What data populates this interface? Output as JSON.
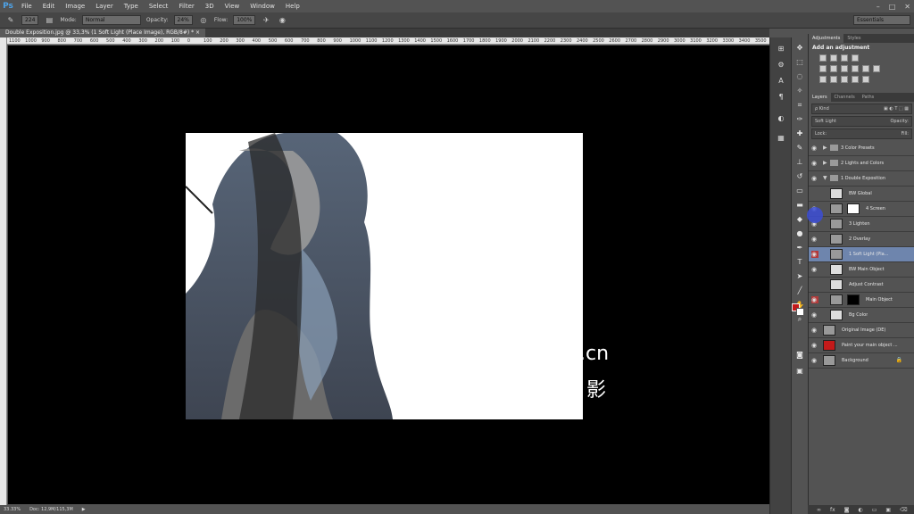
{
  "app": {
    "logo": "Ps"
  },
  "menu": [
    "File",
    "Edit",
    "Image",
    "Layer",
    "Type",
    "Select",
    "Filter",
    "3D",
    "View",
    "Window",
    "Help"
  ],
  "window_controls": [
    "–",
    "□",
    "✕"
  ],
  "options": {
    "brush_size": "224",
    "mode_label": "Mode:",
    "mode_value": "Normal",
    "opacity_label": "Opacity:",
    "opacity_value": "24%",
    "flow_label": "Flow:",
    "flow_value": "100%",
    "workspace": "Essentials"
  },
  "document": {
    "tab": "Double Exposition.jpg @ 33,3% (1 Soft Light (Place Image), RGB/8#) *  ×",
    "ruler_ticks": [
      "1100",
      "1000",
      "900",
      "800",
      "700",
      "600",
      "500",
      "400",
      "300",
      "200",
      "100",
      "0",
      "100",
      "200",
      "300",
      "400",
      "500",
      "600",
      "700",
      "800",
      "900",
      "1000",
      "1100",
      "1200",
      "1300",
      "1400",
      "1500",
      "1600",
      "1700",
      "1800",
      "1900",
      "2000",
      "2100",
      "2200",
      "2300",
      "2400",
      "2500",
      "2600",
      "2700",
      "2800",
      "2900",
      "3000",
      "3100",
      "3200",
      "3300",
      "3400",
      "3500"
    ],
    "watermark": "5.cn",
    "watermark_glyph": "影"
  },
  "status": {
    "zoom": "33.33%",
    "doc": "Doc: 12,9M/115,3M"
  },
  "panels": {
    "adjustments_tab": "Adjustments",
    "styles_tab": "Styles",
    "adjust_title": "Add an adjustment",
    "layers_tab": "Layers",
    "channels_tab": "Channels",
    "paths_tab": "Paths",
    "kind_label": "ρ Kind",
    "blend_mode": "Soft Light",
    "opacity_label": "Opacity:",
    "lock_label": "Lock:",
    "fill_label": "Fill:"
  },
  "layers": [
    {
      "name": "3 Color Presets",
      "type": "group",
      "indent": 0
    },
    {
      "name": "2 Lights and Colors",
      "type": "group",
      "indent": 0
    },
    {
      "name": "1 Double Exposition",
      "type": "group-open",
      "indent": 0
    },
    {
      "name": "BW Global",
      "type": "adjust",
      "indent": 1
    },
    {
      "name": "4 Screen",
      "type": "image-mask",
      "indent": 1
    },
    {
      "name": "3 Lighten",
      "type": "image",
      "indent": 1
    },
    {
      "name": "2 Overlay",
      "type": "image",
      "indent": 1
    },
    {
      "name": "1 Soft Light (Pla...",
      "type": "image",
      "indent": 1,
      "selected": true
    },
    {
      "name": "BW Main Object",
      "type": "adjust",
      "indent": 1
    },
    {
      "name": "Adjust Contrast",
      "type": "adjust",
      "indent": 1
    },
    {
      "name": "Main Object",
      "type": "image-mask",
      "indent": 1
    },
    {
      "name": "Bg Color",
      "type": "fill",
      "indent": 1
    },
    {
      "name": "Original Image (DE)",
      "type": "image",
      "indent": 0
    },
    {
      "name": "Paint your main object ...",
      "type": "image",
      "indent": 0
    },
    {
      "name": "Background",
      "type": "image",
      "indent": 0,
      "locked": true
    }
  ],
  "colors": {
    "accent_selected": "#6e85ad",
    "foreground": "#c41a1a",
    "background": "#ffffff"
  }
}
